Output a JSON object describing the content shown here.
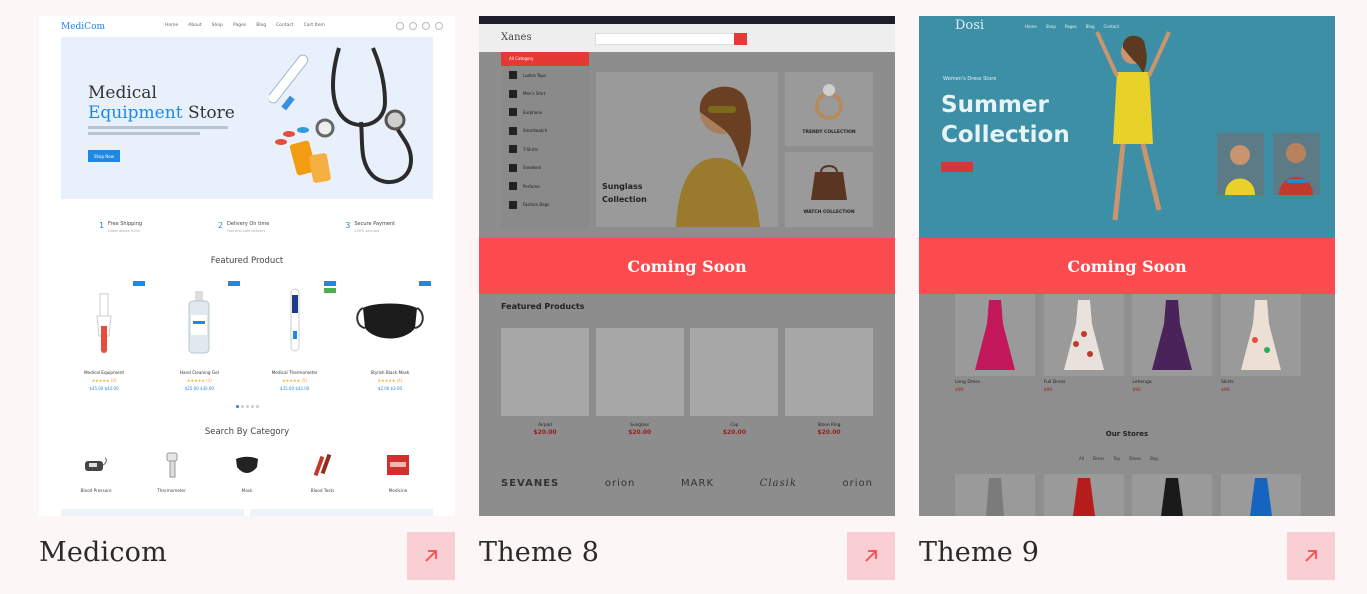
{
  "cards": [
    {
      "title": "Medicom",
      "preview": {
        "logo": "MediCom",
        "nav": [
          "Home",
          "About",
          "Shop",
          "Pages",
          "Blog",
          "Contact",
          "Cart Item"
        ],
        "hero_line1": "Medical",
        "hero_line2_a": "Equipment",
        "hero_line2_b": "Store",
        "hero_button": "Shop Now",
        "features": [
          {
            "num": "1",
            "title": "Free Shipping",
            "sub": "Order above $100"
          },
          {
            "num": "2",
            "title": "Delivery On time",
            "sub": "Fast and safe delivery"
          },
          {
            "num": "3",
            "title": "Secure Payment",
            "sub": "100% secured"
          }
        ],
        "featured_heading": "Featured Product",
        "products": [
          {
            "name": "Medical Equipment",
            "stars": "★★★★★ (4)",
            "price": "$35.00 $42.00"
          },
          {
            "name": "Hand Cleaning Gel",
            "stars": "★★★★★ (3)",
            "price": "$25.00 $30.00"
          },
          {
            "name": "Medical Thermometer",
            "stars": "★★★★★ (5)",
            "price": "$35.00 $42.00"
          },
          {
            "name": "Stylish Black Mask",
            "stars": "★★★★★ (4)",
            "price": "$2.00 $3.00"
          }
        ],
        "category_heading": "Search By Category",
        "categories": [
          "Blood Pressure",
          "Thermometer",
          "Mask",
          "Blood Tests",
          "Medicine"
        ]
      }
    },
    {
      "title": "Theme 8",
      "overlay": "Coming Soon",
      "preview": {
        "logo": "Xanes",
        "all_category": "All Category",
        "categories": [
          "Ladies Tops",
          "Men's Shirt",
          "Earphone",
          "Smartwatch",
          "T-Shirts",
          "Sneakers",
          "Perfume",
          "Fashion Bags"
        ],
        "hero_text_1": "Sunglass",
        "hero_text_2": "Collection",
        "side_1": "TRENDY COLLECTION",
        "side_2": "WATCH COLLECTION",
        "featured_heading": "Featured Products",
        "products": [
          {
            "name": "Airpod",
            "price": "$20.00"
          },
          {
            "name": "Sunglass",
            "price": "$20.00"
          },
          {
            "name": "Cap",
            "price": "$20.00"
          },
          {
            "name": "Stone Ring",
            "price": "$20.00"
          }
        ],
        "brands": [
          "SEVANES",
          "orion",
          "MARK",
          "Clasik",
          "orion"
        ]
      }
    },
    {
      "title": "Theme 9",
      "overlay": "Coming Soon",
      "preview": {
        "logo": "Dosi",
        "nav": [
          "Home",
          "Shop",
          "Pages",
          "Blog",
          "Contact"
        ],
        "subtitle": "Women's Dress Store",
        "title_1": "Summer",
        "title_2": "Collection",
        "dresses": [
          {
            "name": "Long Dress",
            "price": "$90"
          },
          {
            "name": "Full Dress",
            "price": "$90"
          },
          {
            "name": "Lehenga",
            "price": "$90"
          },
          {
            "name": "Skirts",
            "price": "$90"
          }
        ],
        "stores_heading": "Our Stores",
        "store_tabs": [
          "All",
          "Dress",
          "Top",
          "Shoes",
          "Bag"
        ]
      }
    }
  ],
  "colors": {
    "page_bg": "#fdf6f6",
    "coming_soon": "#fb4b4e",
    "link_button": "#f9cfd3",
    "arrow": "#fb4b4e",
    "medicom_blue": "#1e88e5"
  },
  "icons": {
    "link": "arrow-up-right-icon"
  }
}
